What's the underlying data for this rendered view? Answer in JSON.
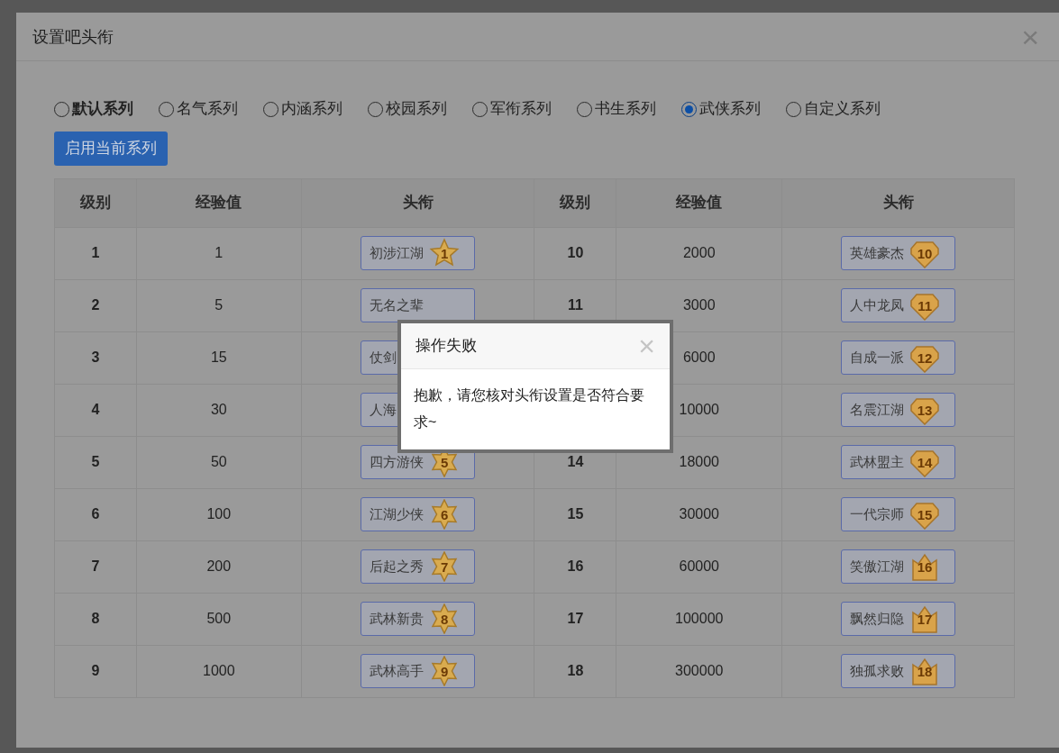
{
  "dialog": {
    "title": "设置吧头衔",
    "close": "×"
  },
  "series": [
    {
      "label": "默认系列",
      "current": true,
      "selected": false
    },
    {
      "label": "名气系列",
      "current": false,
      "selected": false
    },
    {
      "label": "内涵系列",
      "current": false,
      "selected": false
    },
    {
      "label": "校园系列",
      "current": false,
      "selected": false
    },
    {
      "label": "军衔系列",
      "current": false,
      "selected": false
    },
    {
      "label": "书生系列",
      "current": false,
      "selected": false
    },
    {
      "label": "武侠系列",
      "current": false,
      "selected": true
    },
    {
      "label": "自定义系列",
      "current": false,
      "selected": false
    }
  ],
  "apply_button": "启用当前系列",
  "table": {
    "columns": [
      "级别",
      "经验值",
      "头衔",
      "级别",
      "经验值",
      "头衔"
    ],
    "rows": [
      {
        "left": {
          "level": "1",
          "exp": "1",
          "title": "初涉江湖",
          "badge": {
            "kind": "star",
            "number": "1"
          }
        },
        "right": {
          "level": "10",
          "exp": "2000",
          "title": "英雄豪杰",
          "badge": {
            "kind": "gem",
            "number": "10"
          }
        }
      },
      {
        "left": {
          "level": "2",
          "exp": "5",
          "title": "无名之辈"
        },
        "right": {
          "level": "11",
          "exp": "3000",
          "title": "人中龙凤",
          "badge": {
            "kind": "gem",
            "number": "11"
          }
        }
      },
      {
        "left": {
          "level": "3",
          "exp": "15",
          "title": "仗剑"
        },
        "right": {
          "exp": "6000",
          "title": "自成一派",
          "badge": {
            "kind": "gem",
            "number": "12"
          }
        }
      },
      {
        "left": {
          "level": "4",
          "exp": "30",
          "title": "人海"
        },
        "right": {
          "exp": "10000",
          "title": "名震江湖",
          "badge": {
            "kind": "gem",
            "number": "13"
          }
        }
      },
      {
        "left": {
          "level": "5",
          "exp": "50",
          "title": "四方游侠",
          "badge": {
            "kind": "hexstar",
            "number": "5"
          }
        },
        "right": {
          "level": "14",
          "exp": "18000",
          "title": "武林盟主",
          "badge": {
            "kind": "gem",
            "number": "14"
          }
        }
      },
      {
        "left": {
          "level": "6",
          "exp": "100",
          "title": "江湖少侠",
          "badge": {
            "kind": "hexstar",
            "number": "6"
          }
        },
        "right": {
          "level": "15",
          "exp": "30000",
          "title": "一代宗师",
          "badge": {
            "kind": "gem",
            "number": "15"
          }
        }
      },
      {
        "left": {
          "level": "7",
          "exp": "200",
          "title": "后起之秀",
          "badge": {
            "kind": "hexstar",
            "number": "7"
          }
        },
        "right": {
          "level": "16",
          "exp": "60000",
          "title": "笑傲江湖",
          "badge": {
            "kind": "crown",
            "number": "16"
          }
        }
      },
      {
        "left": {
          "level": "8",
          "exp": "500",
          "title": "武林新贵",
          "badge": {
            "kind": "hexstar",
            "number": "8"
          }
        },
        "right": {
          "level": "17",
          "exp": "100000",
          "title": "飘然归隐",
          "badge": {
            "kind": "crown",
            "number": "17"
          }
        }
      },
      {
        "left": {
          "level": "9",
          "exp": "1000",
          "title": "武林高手",
          "badge": {
            "kind": "hexstar",
            "number": "9"
          }
        },
        "right": {
          "level": "18",
          "exp": "300000",
          "title": "独孤求败",
          "badge": {
            "kind": "crown",
            "number": "18"
          }
        }
      }
    ]
  },
  "alert": {
    "title": "操作失败",
    "message": "抱歉，请您核对头衔设置是否符合要求~"
  }
}
